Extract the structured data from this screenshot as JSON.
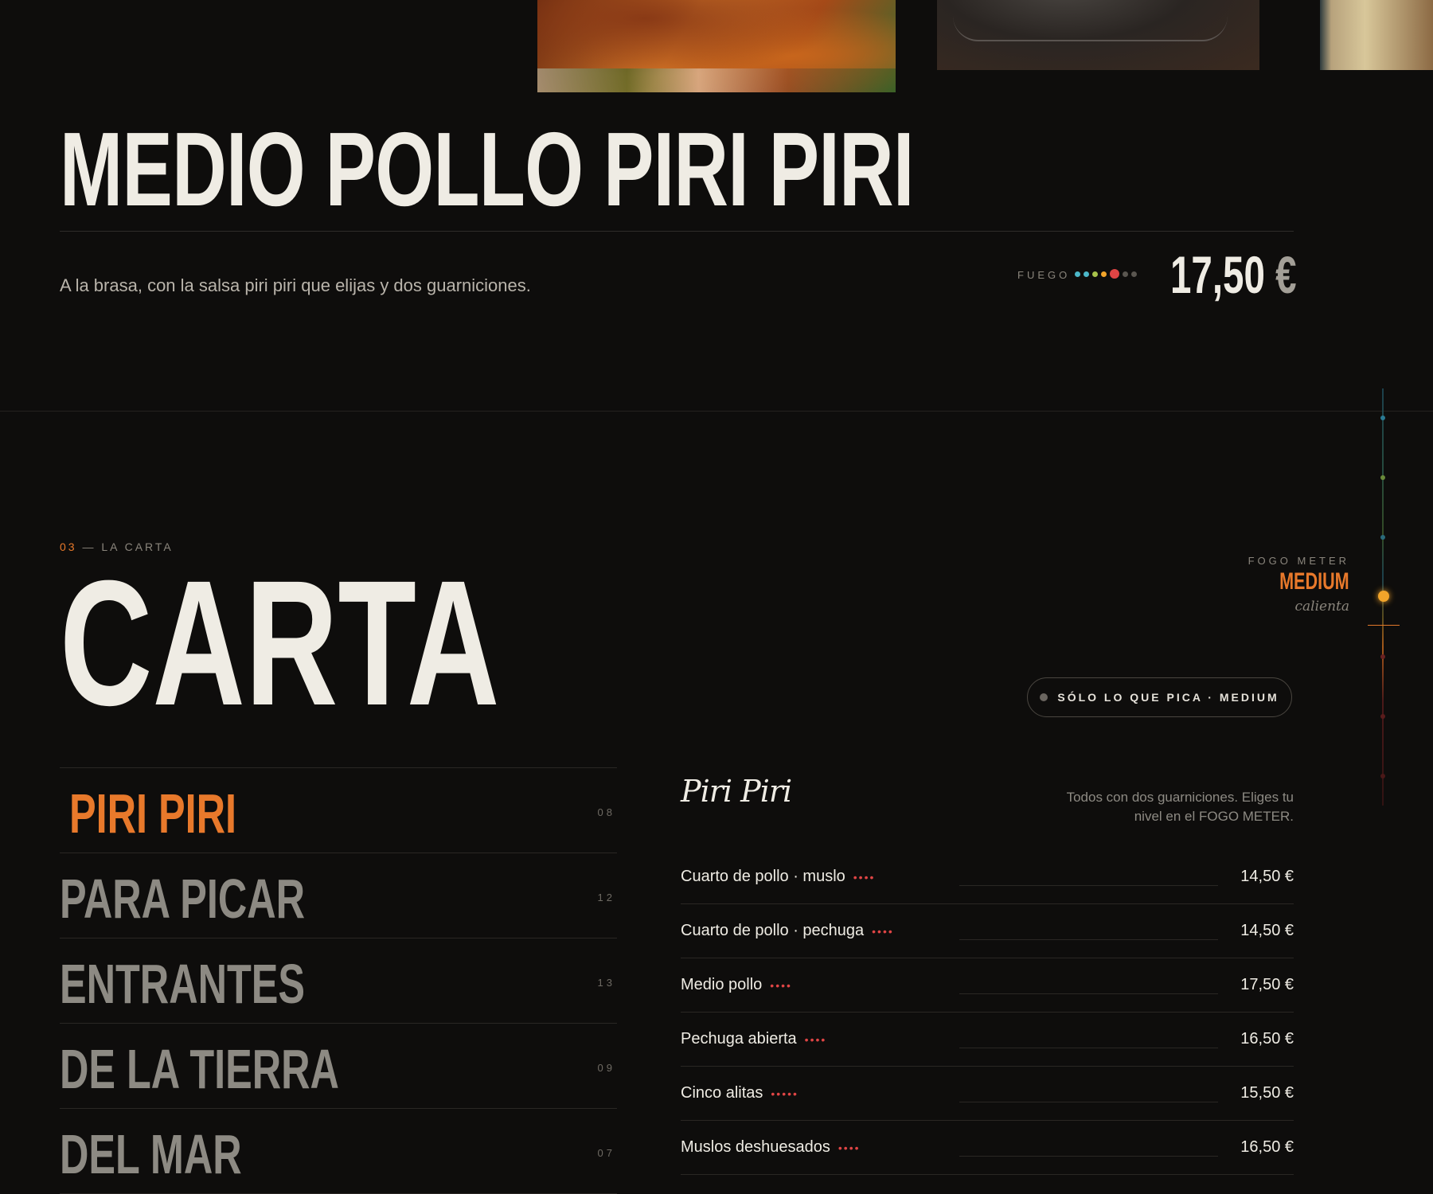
{
  "featured": {
    "title": "MEDIO POLLO PIRI PIRI",
    "description": "A la brasa, con la salsa piri piri que elijas y dos guarniciones.",
    "fuego_label": "FUEGO",
    "fuego_dots": [
      "#4cb7c9",
      "#4cb7c9",
      "#a8c24a",
      "#f2a42a",
      "#e04545",
      "#5a5650",
      "#5a5650"
    ],
    "fuego_level_index": 4,
    "price": "17,50",
    "currency": "€"
  },
  "fogo_meter": {
    "label": "FOGO METER",
    "level": "MEDIUM",
    "sub": "calienta",
    "level_fraction": 0.45
  },
  "section": {
    "number": "03",
    "kicker": " — LA CARTA",
    "title": "CARTA"
  },
  "filter_button": {
    "label": "SÓLO LO QUE PICA · MEDIUM"
  },
  "categories": [
    {
      "name": "PIRI PIRI",
      "count": "08",
      "active": true
    },
    {
      "name": "PARA PICAR",
      "count": "12",
      "active": false
    },
    {
      "name": "ENTRANTES",
      "count": "13",
      "active": false
    },
    {
      "name": "DE LA TIERRA",
      "count": "09",
      "active": false
    },
    {
      "name": "DEL MAR",
      "count": "07",
      "active": false
    }
  ],
  "menu": {
    "heading": "Piri Piri",
    "note": "Todos con dos guarniciones. Eliges tu nivel en el FOGO METER.",
    "items": [
      {
        "name": "Cuarto de pollo · muslo",
        "heat": "••••",
        "price": "14,50 €"
      },
      {
        "name": "Cuarto de pollo · pechuga",
        "heat": "••••",
        "price": "14,50 €"
      },
      {
        "name": "Medio pollo",
        "heat": "••••",
        "price": "17,50 €"
      },
      {
        "name": "Pechuga abierta",
        "heat": "••••",
        "price": "16,50 €"
      },
      {
        "name": "Cinco alitas",
        "heat": "•••••",
        "price": "15,50 €"
      },
      {
        "name": "Muslos deshuesados",
        "heat": "••••",
        "price": "16,50 €"
      }
    ]
  }
}
